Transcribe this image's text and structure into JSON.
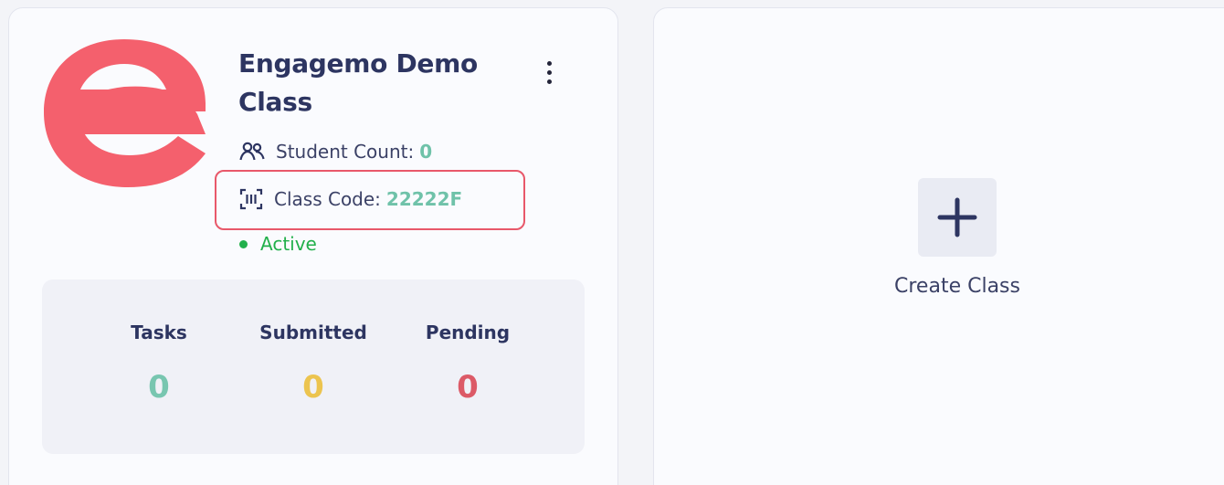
{
  "class_card": {
    "title": "Engagemo Demo Class",
    "student_count_label": "Student Count:",
    "student_count_value": "0",
    "class_code_label": "Class Code:",
    "class_code_value": "22222F",
    "status": "Active",
    "stats": [
      {
        "label": "Tasks",
        "value": "0",
        "color": "#78c6b0"
      },
      {
        "label": "Submitted",
        "value": "0",
        "color": "#ecc44f"
      },
      {
        "label": "Pending",
        "value": "0",
        "color": "#dc5a67"
      }
    ]
  },
  "create_card": {
    "label": "Create Class"
  },
  "colors": {
    "brand_logo": "#f4606d",
    "title": "#2d3561",
    "highlight": "#e8586a",
    "active": "#22b04b",
    "code_value": "#6fc2a9"
  },
  "icons": {
    "logo": "engagemo-e-logo",
    "more": "vertical-dots-icon",
    "students": "users-icon",
    "code": "barcode-scan-icon",
    "status": "status-dot",
    "create": "plus-icon"
  }
}
